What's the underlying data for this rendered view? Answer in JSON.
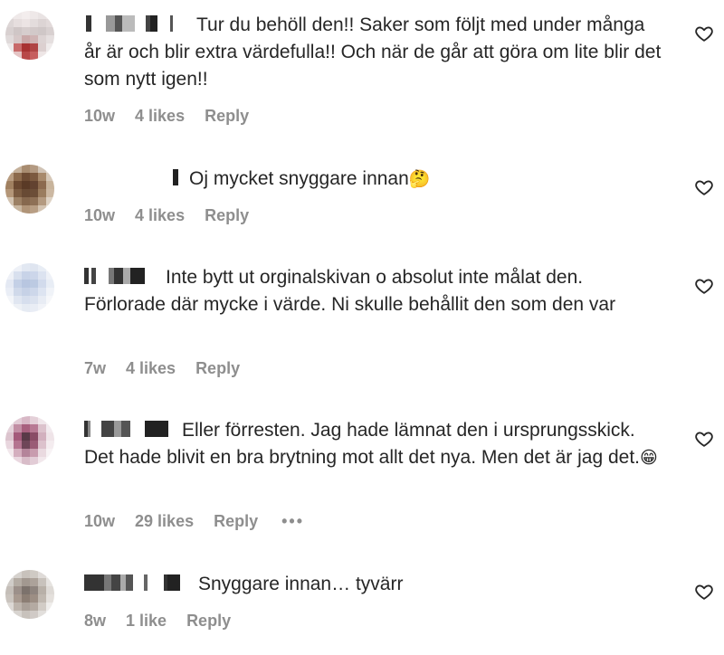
{
  "comments": [
    {
      "text": "Tur du behöll den!! Saker som följt med under många år är och blir extra värdefulla!! Och när de går att göra om lite blir det som nytt igen!!",
      "time": "10w",
      "likes": "4 likes",
      "reply": "Reply",
      "more": ""
    },
    {
      "text": "Oj mycket snyggare innan",
      "emoji": "🤔",
      "time": "10w",
      "likes": "4 likes",
      "reply": "Reply",
      "more": ""
    },
    {
      "text": "Inte bytt ut orginalskivan o absolut inte målat den. Förlorade där mycke i värde. Ni skulle behållit den som den var",
      "time": "7w",
      "likes": "4 likes",
      "reply": "Reply",
      "more": ""
    },
    {
      "text": "Eller förresten. Jag hade lämnat den i ursprungsskick. Det hade blivit en bra brytning mot allt det nya. Men det är jag det.",
      "emoji": "😁",
      "time": "10w",
      "likes": "29 likes",
      "reply": "Reply",
      "more": "•••"
    },
    {
      "text": "Snyggare innan… tyvärr",
      "time": "8w",
      "likes": "1 like",
      "reply": "Reply",
      "more": ""
    }
  ],
  "icons": {
    "heart": "heart-icon",
    "more": "more-options-icon"
  },
  "colors": {
    "text": "#262626",
    "meta": "#8e8e8e",
    "background": "#ffffff"
  }
}
